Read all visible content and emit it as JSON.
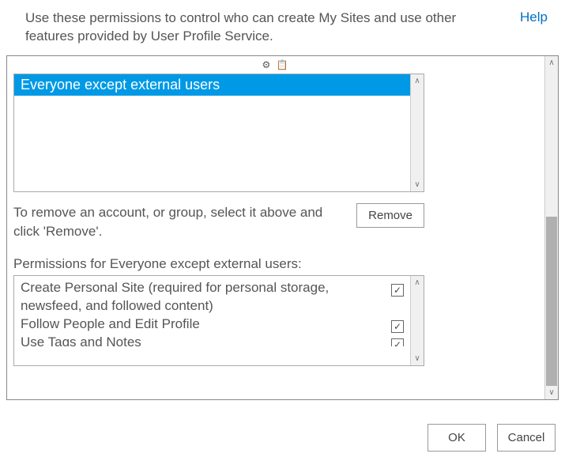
{
  "header": {
    "description": "Use these permissions to control who can create My Sites and use other features provided by User Profile Service.",
    "help_label": "Help"
  },
  "toolbar": {
    "icons": "⚙ 📋"
  },
  "users": {
    "selected": "Everyone except external users"
  },
  "remove": {
    "text": "To remove an account, or group, select it above and click 'Remove'.",
    "button_label": "Remove"
  },
  "permissions": {
    "label": "Permissions for Everyone except external users:",
    "items": [
      {
        "label": "Create Personal Site (required for personal storage, newsfeed, and followed content)",
        "checked": true
      },
      {
        "label": "Follow People and Edit Profile",
        "checked": true
      },
      {
        "label": "Use Tags and Notes",
        "checked": true
      }
    ]
  },
  "buttons": {
    "ok": "OK",
    "cancel": "Cancel"
  }
}
